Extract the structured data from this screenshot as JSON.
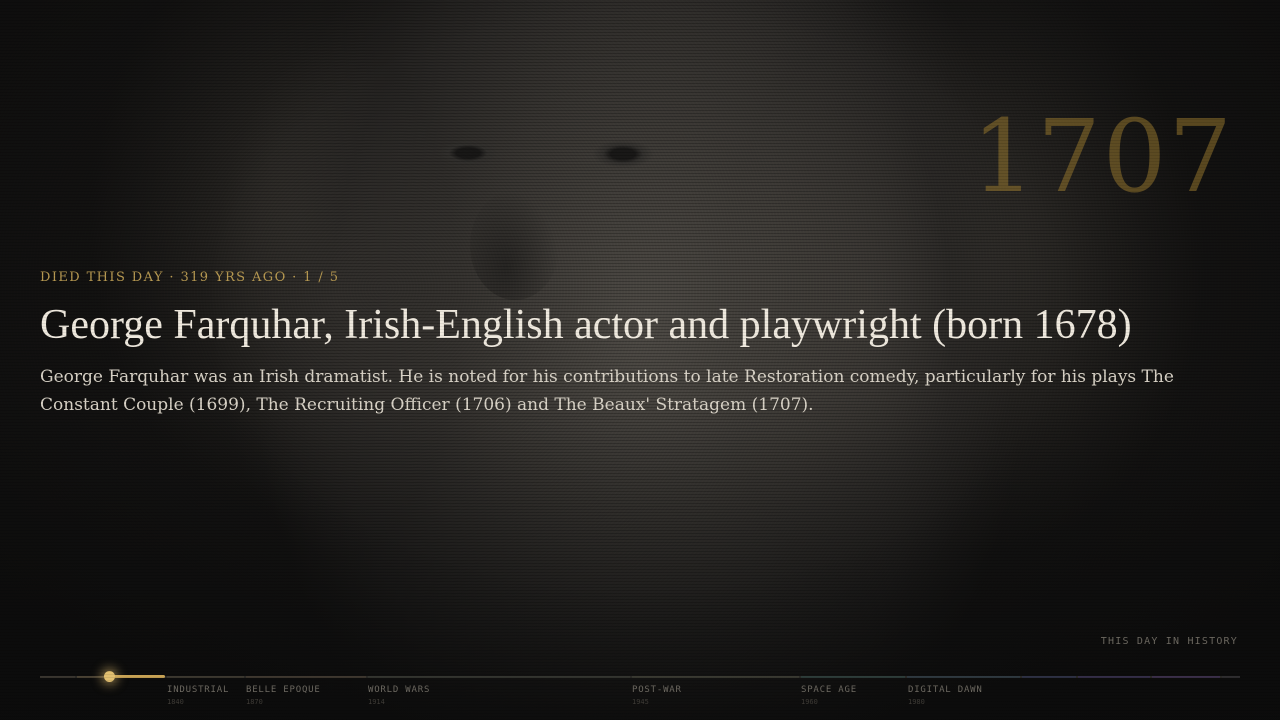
{
  "event": {
    "eyebrow": "DIED THIS DAY · 319 YRS AGO · 1 / 5",
    "title": "George Farquhar, Irish-English actor and playwright (born 1678)",
    "description": "George Farquhar was an Irish dramatist. He is noted for his contributions to late Restoration comedy, particularly for his plays The Constant Couple (1699), The Recruiting Officer (1706) and The Beaux' Stratagem (1707).",
    "year": "1707"
  },
  "section_label": "THIS DAY IN HISTORY",
  "timeline": {
    "progress_color": "#c7a255",
    "eras": [
      {
        "name": "INDUSTRIAL",
        "year": "1840"
      },
      {
        "name": "BELLE EPOQUE",
        "year": "1870"
      },
      {
        "name": "WORLD WARS",
        "year": "1914"
      },
      {
        "name": "POST-WAR",
        "year": "1945"
      },
      {
        "name": "SPACE AGE",
        "year": "1960"
      },
      {
        "name": "DIGITAL DAWN",
        "year": "1980"
      }
    ]
  }
}
